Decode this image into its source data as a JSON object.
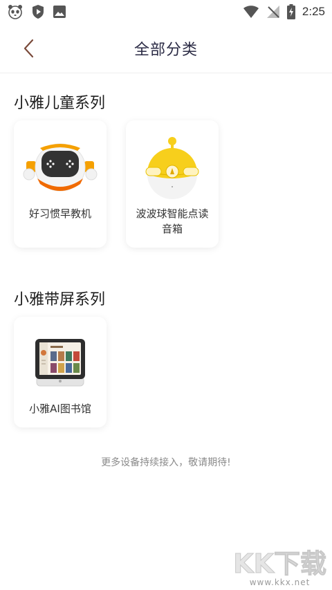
{
  "status_bar": {
    "time": "2:25"
  },
  "header": {
    "title": "全部分类"
  },
  "sections": [
    {
      "title": "小雅儿童系列",
      "items": [
        {
          "label": "好习惯早教机"
        },
        {
          "label": "波波球智能点读音箱"
        }
      ]
    },
    {
      "title": "小雅带屏系列",
      "items": [
        {
          "label": "小雅AI图书馆"
        }
      ]
    }
  ],
  "footer": {
    "note": "更多设备持续接入，敬请期待!"
  },
  "watermark": {
    "brand": "KK下载",
    "url": "www.kkx.net"
  },
  "colors": {
    "robot_accent": "#f5a000",
    "ball_yellow": "#f7cf1c",
    "screen_frame": "#2d2d2d"
  }
}
